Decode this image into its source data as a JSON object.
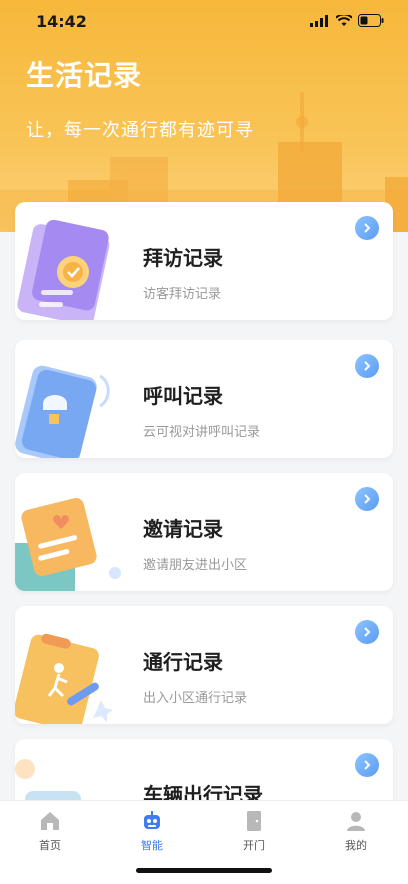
{
  "status_bar": {
    "time": "14:42"
  },
  "header": {
    "title": "生活记录",
    "subtitle": "让，每一次通行都有迹可寻"
  },
  "cards": [
    {
      "title": "拜访记录",
      "desc": "访客拜访记录"
    },
    {
      "title": "呼叫记录",
      "desc": "云可视对讲呼叫记录"
    },
    {
      "title": "邀请记录",
      "desc": "邀请朋友进出小区"
    },
    {
      "title": "通行记录",
      "desc": "出入小区通行记录"
    },
    {
      "title": "车辆出行记录",
      "desc": ""
    }
  ],
  "tabbar": {
    "items": [
      {
        "label": "首页",
        "icon": "home-icon",
        "active": false
      },
      {
        "label": "智能",
        "icon": "robot-icon",
        "active": true
      },
      {
        "label": "开门",
        "icon": "door-icon",
        "active": false
      },
      {
        "label": "我的",
        "icon": "profile-icon",
        "active": false
      }
    ]
  },
  "colors": {
    "accent": "#3e7df2",
    "hero": "#f7b83b"
  }
}
